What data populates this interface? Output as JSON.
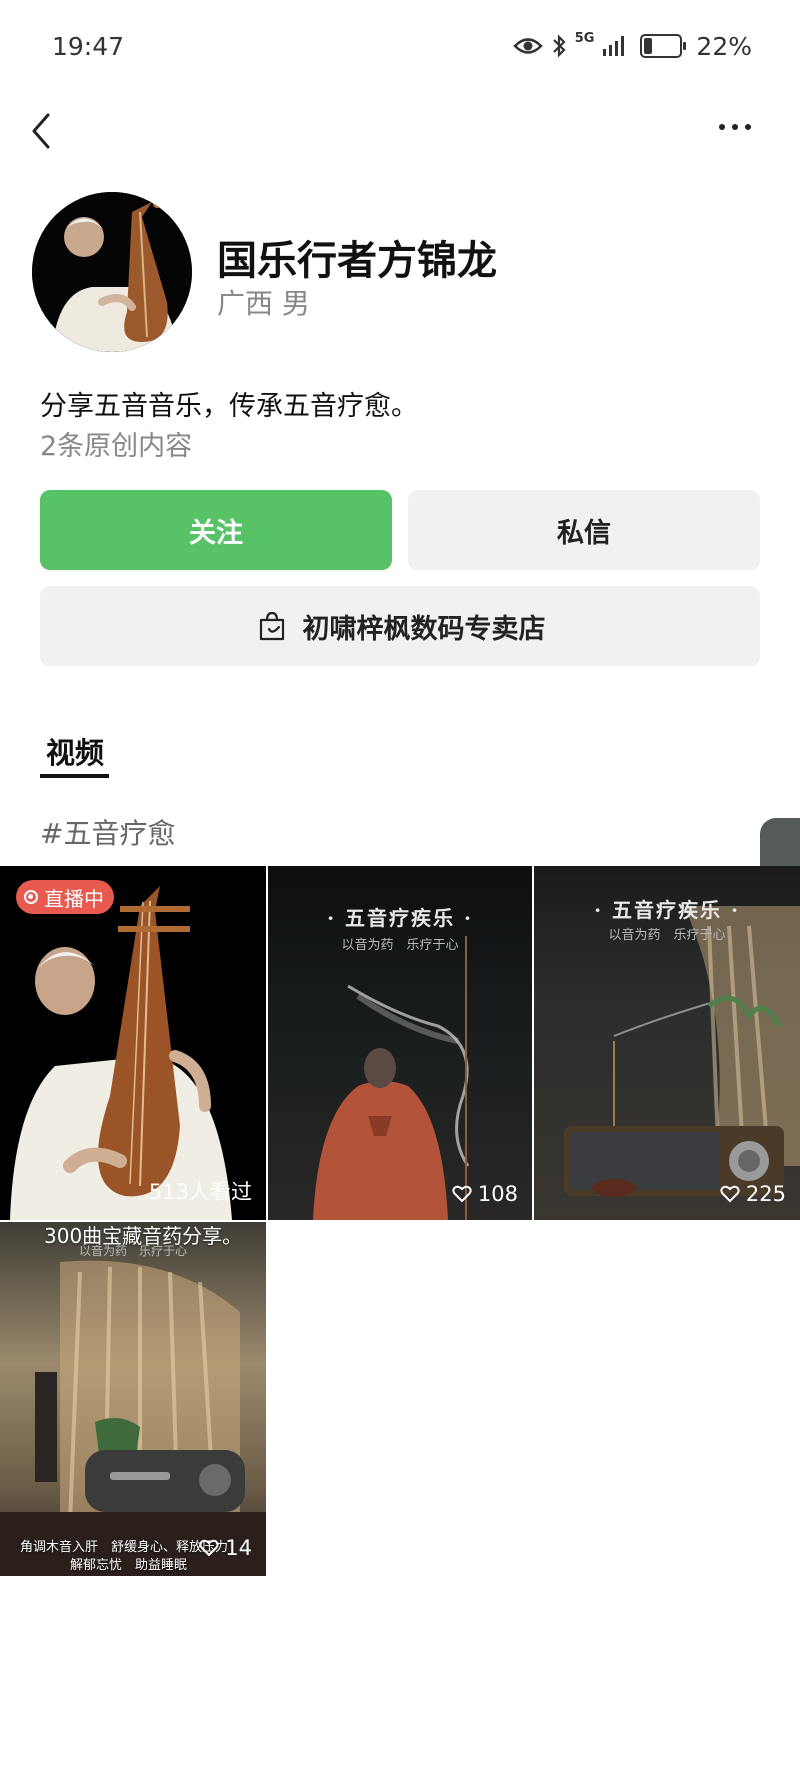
{
  "status_bar": {
    "time": "19:47",
    "network": "5G",
    "battery": "22%"
  },
  "profile": {
    "name": "国乐行者方锦龙",
    "meta": "广西 男",
    "bio": "分享五音音乐，传承五音疗愈。",
    "content_count": "2条原创内容"
  },
  "actions": {
    "follow": "关注",
    "message": "私信",
    "shop": "初啸梓枫数码专卖店"
  },
  "tabs": [
    {
      "label": "视频"
    }
  ],
  "hashtag": "#五音疗愈",
  "videos": [
    {
      "badge": "直播中",
      "stat": "513人看过"
    },
    {
      "title": "· 五音疗疾乐 ·",
      "subtitle": "以音为药　乐疗于心",
      "likes": "108"
    },
    {
      "title": "· 五音疗疾乐 ·",
      "subtitle": "以音为药　乐疗于心",
      "likes": "225"
    },
    {
      "top_caption": "300曲宝藏音药分享。",
      "top_sub": "以音为药　乐疗于心",
      "bottom_line1": "角调木音入肝　舒缓身心、释放压力",
      "bottom_line2": "解郁忘忧　助益睡眠",
      "likes": "14"
    }
  ],
  "colors": {
    "accent": "#57c266",
    "live": "#e85a4f"
  }
}
